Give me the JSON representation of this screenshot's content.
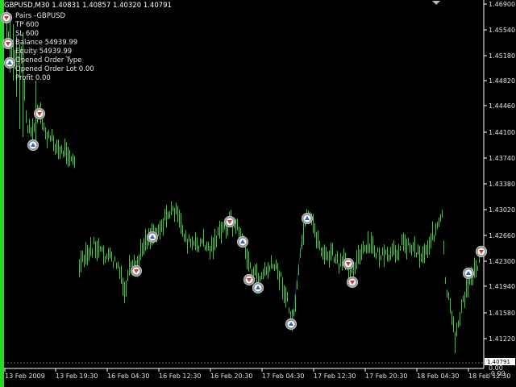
{
  "header": {
    "symbol_timeframe": "GBPUSD,M30",
    "ohlc": "1.40831 1.40857 1.40320 1.40791"
  },
  "info_panel": {
    "lines": [
      "Pairs -GBPUSD",
      "TP 600",
      "SL 600",
      "Balance 54939.99",
      "Equity 54939.99",
      "Opened Order Type",
      "Opened Order Lot 0.00",
      "Profit 0.00"
    ]
  },
  "price_axis": {
    "labels": [
      "1.46900",
      "1.45540",
      "1.45180",
      "1.44820",
      "1.44460",
      "1.44100",
      "1.43740",
      "1.43380",
      "1.43020",
      "1.42660",
      "1.42300",
      "1.41940",
      "1.41580",
      "1.41220",
      "1.40791"
    ],
    "bottom_labels": [
      "0.00",
      "-0.00"
    ],
    "current_price": "1.40791"
  },
  "time_axis": {
    "labels": [
      "13 Feb 2009",
      "13 Feb 19:30",
      "16 Feb 04:30",
      "16 Feb 12:30",
      "16 Feb 20:30",
      "17 Feb 04:30",
      "17 Feb 12:30",
      "17 Feb 20:30",
      "18 Feb 04:30",
      "18 Feb 12:30"
    ]
  },
  "colors": {
    "background": "#000000",
    "bars": "#33cc33",
    "buy_marker": "#2266dd",
    "sell_marker": "#dd3322",
    "marker_ring": "#bbbbbb",
    "axis": "#ffffff"
  },
  "chart_data": {
    "type": "bar",
    "symbol": "GBPUSD",
    "timeframe": "M30",
    "ylim": [
      1.4079,
      1.469
    ],
    "last_ohlc": {
      "open": 1.40831,
      "high": 1.40857,
      "low": 1.4032,
      "close": 1.40791
    }
  },
  "trade_markers": [
    {
      "type": "sell",
      "icon": "sell-arrow-icon"
    },
    {
      "type": "sell",
      "icon": "sell-arrow-icon"
    },
    {
      "type": "buy",
      "icon": "buy-arrow-icon"
    },
    {
      "type": "sell",
      "icon": "sell-arrow-icon"
    },
    {
      "type": "buy",
      "icon": "buy-arrow-icon"
    },
    {
      "type": "buy",
      "icon": "buy-arrow-icon"
    },
    {
      "type": "sell",
      "icon": "sell-arrow-icon"
    },
    {
      "type": "sell",
      "icon": "sell-arrow-icon"
    },
    {
      "type": "buy",
      "icon": "buy-arrow-icon"
    },
    {
      "type": "sell",
      "icon": "sell-arrow-icon"
    },
    {
      "type": "buy",
      "icon": "buy-arrow-icon"
    },
    {
      "type": "buy",
      "icon": "buy-arrow-icon"
    },
    {
      "type": "sell",
      "icon": "sell-arrow-icon"
    },
    {
      "type": "sell",
      "icon": "sell-arrow-icon"
    },
    {
      "type": "buy",
      "icon": "buy-arrow-icon"
    },
    {
      "type": "sell",
      "icon": "sell-arrow-icon"
    },
    {
      "type": "buy",
      "icon": "buy-arrow-icon"
    },
    {
      "type": "sell",
      "icon": "sell-arrow-icon"
    }
  ]
}
